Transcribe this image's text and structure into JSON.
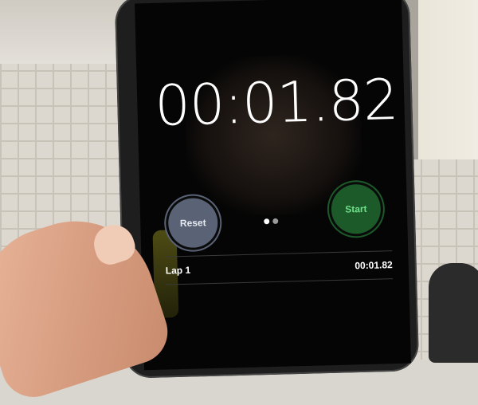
{
  "stopwatch": {
    "time": "00:01.82",
    "reset_label": "Reset",
    "start_label": "Start",
    "page_dots": 2,
    "laps": [
      {
        "label": "Lap 1",
        "time": "00:01.82"
      }
    ]
  },
  "colors": {
    "reset_button": "#5a6376",
    "start_button": "#1c5a2a",
    "start_text": "#6fe08a",
    "screen": "#050505"
  }
}
